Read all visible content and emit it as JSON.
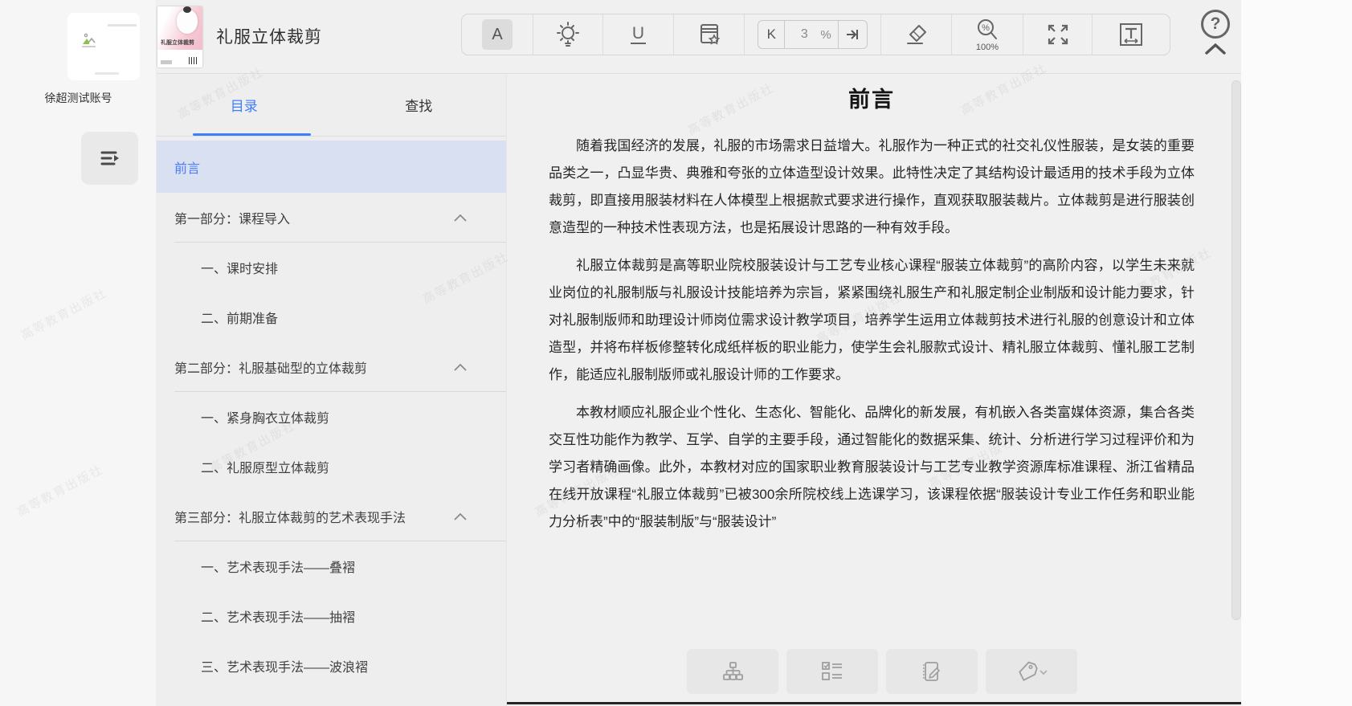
{
  "account": {
    "name": "徐超测试账号"
  },
  "header": {
    "book_title": "礼服立体裁剪",
    "cover_label": "礼服立体裁剪",
    "toolbar": {
      "font_label": "A",
      "underline_label": "U",
      "k_label": "K",
      "page_percent_value": "3",
      "percent_sign": "%",
      "zoom_level": "100%",
      "help_label": "?"
    }
  },
  "toc": {
    "tabs": [
      {
        "label": "目录",
        "active": true
      },
      {
        "label": "查找",
        "active": false
      }
    ],
    "items": [
      {
        "label": "前言",
        "level": 0,
        "selected": true
      },
      {
        "label": "第一部分：课程导入",
        "level": 0,
        "section": true,
        "expanded": true
      },
      {
        "label": "一、课时安排",
        "level": 1
      },
      {
        "label": "二、前期准备",
        "level": 1
      },
      {
        "label": "第二部分：礼服基础型的立体裁剪",
        "level": 0,
        "section": true,
        "expanded": true
      },
      {
        "label": "一、紧身胸衣立体裁剪",
        "level": 1
      },
      {
        "label": "二、礼服原型立体裁剪",
        "level": 1
      },
      {
        "label": "第三部分：礼服立体裁剪的艺术表现手法",
        "level": 0,
        "section": true,
        "expanded": true
      },
      {
        "label": "一、艺术表现手法——叠褶",
        "level": 1
      },
      {
        "label": "二、艺术表现手法——抽褶",
        "level": 1
      },
      {
        "label": "三、艺术表现手法——波浪褶",
        "level": 1
      }
    ]
  },
  "content": {
    "title": "前言",
    "paragraphs": [
      "随着我国经济的发展，礼服的市场需求日益增大。礼服作为一种正式的社交礼仪性服装，是女装的重要品类之一，凸显华贵、典雅和夸张的立体造型设计效果。此特性决定了其结构设计最适用的技术手段为立体裁剪，即直接用服装材料在人体模型上根据款式要求进行操作，直观获取服装裁片。立体裁剪是进行服装创意造型的一种技术性表现方法，也是拓展设计思路的一种有效手段。",
      "礼服立体裁剪是高等职业院校服装设计与工艺专业核心课程“服装立体裁剪”的高阶内容，以学生未来就业岗位的礼服制版与礼服设计技能培养为宗旨，紧紧围绕礼服生产和礼服定制企业制版和设计能力要求，针对礼服制版师和助理设计师岗位需求设计教学项目，培养学生运用立体裁剪技术进行礼服的创意设计和立体造型，并将布样板修整转化成纸样板的职业能力，使学生会礼服款式设计、精礼服立体裁剪、懂礼服工艺制作，能适应礼服制版师或礼服设计师的工作要求。",
      "本教材顺应礼服企业个性化、生态化、智能化、品牌化的新发展，有机嵌入各类富媒体资源，集合各类交互性功能作为教学、互学、自学的主要手段，通过智能化的数据采集、统计、分析进行学习过程评价和为学习者精确画像。此外，本教材对应的国家职业教育服装设计与工艺专业教学资源库标准课程、浙江省精品在线开放课程“礼服立体裁剪”已被300余所院校线上选课学习，该课程依据“服装设计专业工作任务和职业能力分析表”中的“服装制版”与“服装设计”"
    ]
  },
  "watermark": {
    "text": "高等教育出版社"
  },
  "colors": {
    "accent": "#3d7eff",
    "toc_selected_bg": "#d9e0f1",
    "content_bg": "#f0f0f0"
  }
}
